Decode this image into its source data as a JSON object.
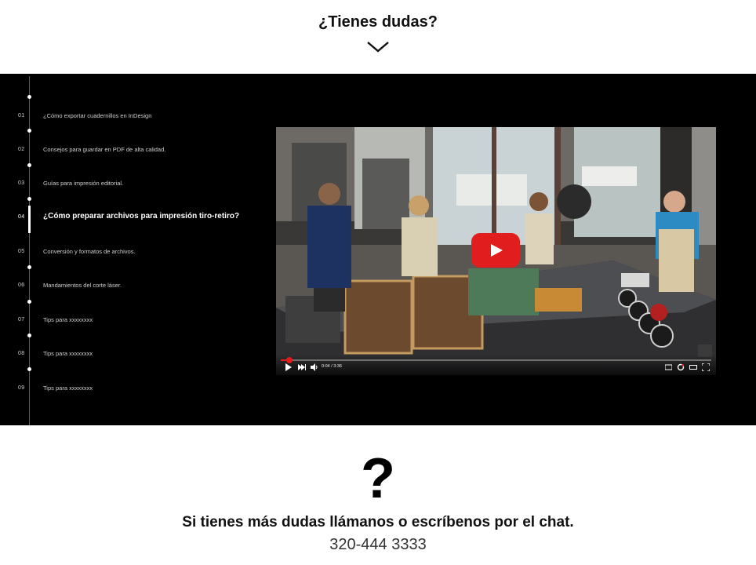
{
  "header": {
    "title": "¿Tienes dudas?",
    "toggle_icon": "chevron-down-icon"
  },
  "topics": [
    {
      "num": "01",
      "label": "¿Cómo exportar cuadernillos en InDesign",
      "active": false
    },
    {
      "num": "02",
      "label": "Consejos para guardar en PDF de alta calidad.",
      "active": false
    },
    {
      "num": "03",
      "label": "Guías para impresión editorial.",
      "active": false
    },
    {
      "num": "04",
      "label": "¿Cómo preparar archivos para impresión tiro-retiro?",
      "active": true
    },
    {
      "num": "05",
      "label": "Conversión y formatos de archivos.",
      "active": false
    },
    {
      "num": "06",
      "label": "Mandamientos del corte láser.",
      "active": false
    },
    {
      "num": "07",
      "label": "Tips para xxxxxxxx",
      "active": false
    },
    {
      "num": "08",
      "label": "Tips para xxxxxxxx",
      "active": false
    },
    {
      "num": "09",
      "label": "Tips para xxxxxxxx",
      "active": false
    }
  ],
  "video": {
    "time": "0:04 / 3:36",
    "progress": 0.02,
    "accent": "#e21d1d",
    "play_icon": "youtube-play-icon"
  },
  "contact": {
    "symbol": "?",
    "text": "Si tienes más dudas llámanos o escríbenos por el chat.",
    "phone": "320-444 3333"
  },
  "colors": {
    "section_bg": "#000000",
    "page_bg": "#ffffff"
  }
}
